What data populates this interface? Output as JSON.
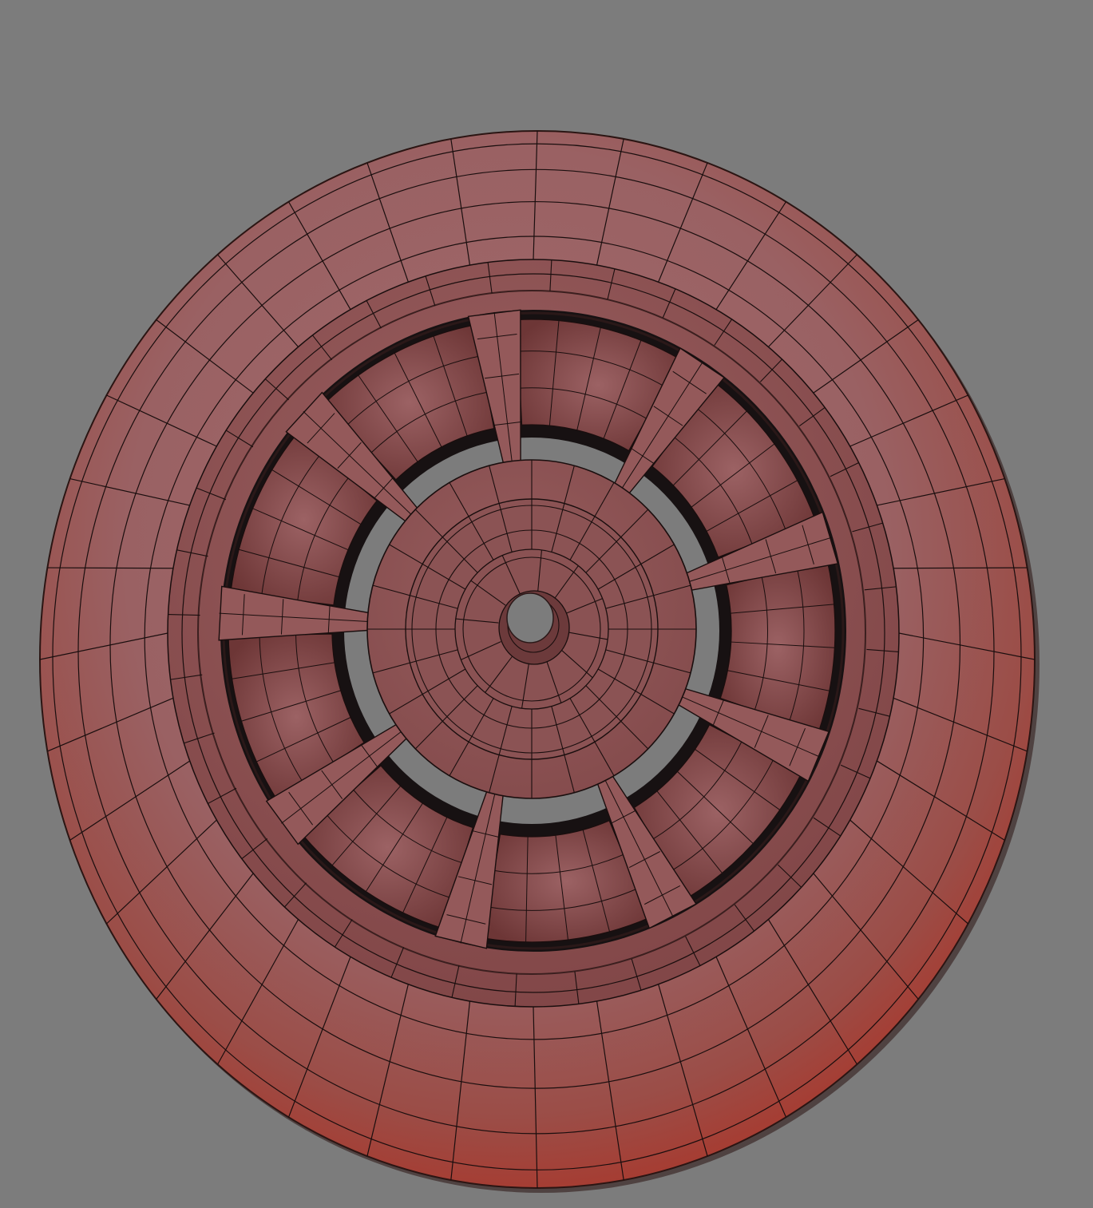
{
  "scene": {
    "background_color": "#7c7c7c",
    "object": "wheel-mesh",
    "colors": {
      "tire_outer": "#a9423a",
      "tire_mid": "#965a5a",
      "tire_light": "#a06a6c",
      "rim": "#935a5b",
      "rim_dark": "#6e3a3a",
      "hub": "#8f5657",
      "cavity": "#171112",
      "wire": "#1a0e0e",
      "hole": "#7c7c7c"
    },
    "spoke_count": 9
  }
}
